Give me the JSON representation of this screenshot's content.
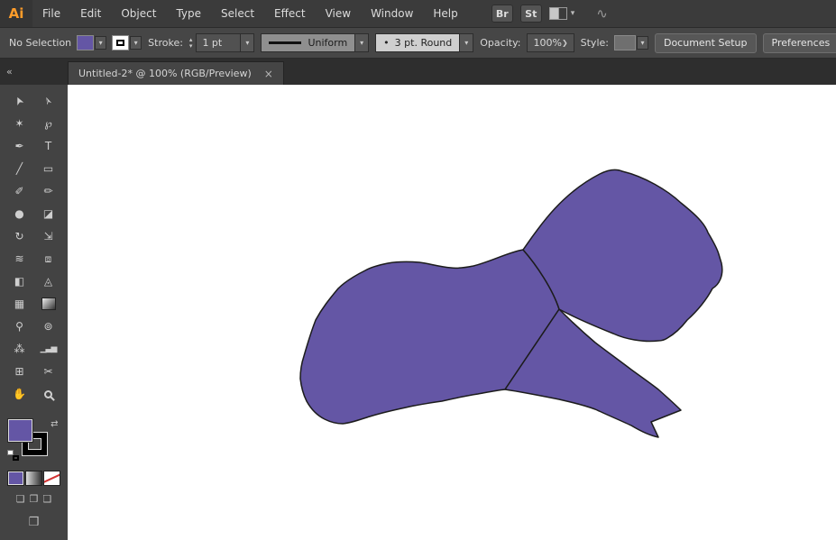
{
  "colors": {
    "accent_purple": "#6456a5",
    "ui_dark": "#3b3b3b",
    "canvas_bg": "#ffffff",
    "logo_orange": "#ff9c2a",
    "none_red": "#d23333"
  },
  "menubar": {
    "logo": "Ai",
    "items": [
      "File",
      "Edit",
      "Object",
      "Type",
      "Select",
      "Effect",
      "View",
      "Window",
      "Help"
    ],
    "bridge_label": "Br",
    "stock_label": "St"
  },
  "controlbar": {
    "selection_status": "No Selection",
    "stroke_label": "Stroke:",
    "stroke_weight": "1 pt",
    "width_profile": "Uniform",
    "brush_dot": "•",
    "brush_name": "3 pt. Round",
    "opacity_label": "Opacity:",
    "opacity_value": "100%",
    "style_label": "Style:",
    "document_setup_label": "Document Setup",
    "preferences_label": "Preferences",
    "edge_glyph": "≣"
  },
  "tabbar": {
    "collapse_glyph": "«",
    "title": "Untitled-2* @ 100% (RGB/Preview)",
    "close_glyph": "×"
  },
  "icons": {
    "chevron_down": "▾",
    "chevron_right": "❯",
    "stepper_up": "▴",
    "stepper_down": "▾",
    "extra": "∿"
  },
  "toolbar": {
    "tools": [
      {
        "name": "selection-tool",
        "glyph": "➤"
      },
      {
        "name": "direct-selection-tool",
        "glyph": "➢"
      },
      {
        "name": "magic-wand-tool",
        "glyph": "✶"
      },
      {
        "name": "lasso-tool",
        "glyph": "℘"
      },
      {
        "name": "pen-tool",
        "glyph": "✒"
      },
      {
        "name": "type-tool",
        "glyph": "T"
      },
      {
        "name": "line-segment-tool",
        "glyph": "╱"
      },
      {
        "name": "rectangle-tool",
        "glyph": "▭"
      },
      {
        "name": "paintbrush-tool",
        "glyph": "✐"
      },
      {
        "name": "pencil-tool",
        "glyph": "✏"
      },
      {
        "name": "blob-brush-tool",
        "glyph": "●"
      },
      {
        "name": "eraser-tool",
        "glyph": "◪"
      },
      {
        "name": "rotate-tool",
        "glyph": "↻"
      },
      {
        "name": "scale-tool",
        "glyph": "⇲"
      },
      {
        "name": "width-tool",
        "glyph": "≋"
      },
      {
        "name": "free-transform-tool",
        "glyph": "⧈"
      },
      {
        "name": "shape-builder-tool",
        "glyph": "◧"
      },
      {
        "name": "perspective-grid-tool",
        "glyph": "◬"
      },
      {
        "name": "mesh-tool",
        "glyph": "▦"
      },
      {
        "name": "gradient-tool",
        "glyph": ""
      },
      {
        "name": "eyedropper-tool",
        "glyph": "⚲"
      },
      {
        "name": "blend-tool",
        "glyph": "⊚"
      },
      {
        "name": "symbol-sprayer-tool",
        "glyph": "⁂"
      },
      {
        "name": "column-graph-tool",
        "glyph": "▁▃▅"
      },
      {
        "name": "artboard-tool",
        "glyph": "⊞"
      },
      {
        "name": "slice-tool",
        "glyph": "✂"
      },
      {
        "name": "hand-tool",
        "glyph": "✋"
      },
      {
        "name": "zoom-tool",
        "glyph": ""
      }
    ],
    "swap_glyph": "⇄",
    "draw_modes": [
      "❏",
      "❐",
      "❑"
    ],
    "screen_mode_glyph": "❒"
  },
  "canvas": {
    "shape_fill": "#6456a5",
    "shape_stroke": "#1c1c1c"
  }
}
